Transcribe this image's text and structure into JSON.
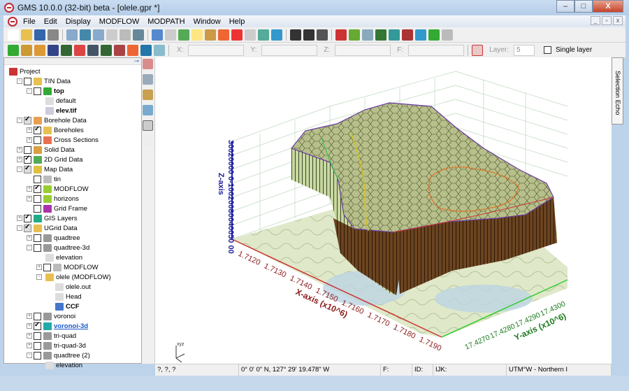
{
  "window": {
    "title": "GMS 10.0.0 (32-bit) beta - [olele.gpr *]",
    "minimize": "–",
    "maximize": "□",
    "close": "X"
  },
  "menu": [
    "File",
    "Edit",
    "Display",
    "MODFLOW",
    "MODPATH",
    "Window",
    "Help"
  ],
  "mdi": {
    "minimize": "_",
    "restore": "▫",
    "close": "x"
  },
  "coords": {
    "x_label": "X:",
    "y_label": "Y:",
    "z_label": "Z:",
    "f_label": "F:",
    "layer_label": "Layer:",
    "layer_value": "5",
    "single_layer": "Single layer"
  },
  "tree": [
    {
      "label": "Project",
      "level": 0,
      "exp": "",
      "chk": "none",
      "icon": "#c33",
      "style": ""
    },
    {
      "label": "TIN Data",
      "level": 1,
      "exp": "-",
      "chk": "off",
      "icon": "#e8c050",
      "style": ""
    },
    {
      "label": "top",
      "level": 2,
      "exp": "-",
      "chk": "off",
      "icon": "#3a3",
      "style": "bold"
    },
    {
      "label": "default",
      "level": 3,
      "exp": "",
      "chk": "none",
      "icon": "#ddd",
      "style": ""
    },
    {
      "label": "elev.tif",
      "level": 3,
      "exp": "",
      "chk": "none",
      "icon": "#ccd",
      "style": "bold"
    },
    {
      "label": "Borehole Data",
      "level": 1,
      "exp": "-",
      "chk": "grey",
      "icon": "#e8a050",
      "style": ""
    },
    {
      "label": "Boreholes",
      "level": 2,
      "exp": "+",
      "chk": "on",
      "icon": "#e8c050",
      "style": ""
    },
    {
      "label": "Cross Sections",
      "level": 2,
      "exp": "+",
      "chk": "off",
      "icon": "#e87050",
      "style": ""
    },
    {
      "label": "Solid Data",
      "level": 1,
      "exp": "+",
      "chk": "off",
      "icon": "#d9a040",
      "style": ""
    },
    {
      "label": "2D Grid Data",
      "level": 1,
      "exp": "+",
      "chk": "on",
      "icon": "#5a5",
      "style": ""
    },
    {
      "label": "Map Data",
      "level": 1,
      "exp": "-",
      "chk": "grey",
      "icon": "#e0c040",
      "style": ""
    },
    {
      "label": "tin",
      "level": 2,
      "exp": "",
      "chk": "off",
      "icon": "#bbb",
      "style": ""
    },
    {
      "label": "MODFLOW",
      "level": 2,
      "exp": "+",
      "chk": "on",
      "icon": "#9c3",
      "style": ""
    },
    {
      "label": "horizons",
      "level": 2,
      "exp": "+",
      "chk": "off",
      "icon": "#9c3",
      "style": ""
    },
    {
      "label": "Grid Frame",
      "level": 2,
      "exp": "",
      "chk": "off",
      "icon": "#a3a",
      "style": ""
    },
    {
      "label": "GIS Layers",
      "level": 1,
      "exp": "+",
      "chk": "on",
      "icon": "#2a8",
      "style": ""
    },
    {
      "label": "UGrid Data",
      "level": 1,
      "exp": "-",
      "chk": "grey",
      "icon": "#e8c050",
      "style": ""
    },
    {
      "label": "quadtree",
      "level": 2,
      "exp": "+",
      "chk": "off",
      "icon": "#999",
      "style": ""
    },
    {
      "label": "quadtree-3d",
      "level": 2,
      "exp": "-",
      "chk": "off",
      "icon": "#999",
      "style": ""
    },
    {
      "label": "elevation",
      "level": 3,
      "exp": "",
      "chk": "none",
      "icon": "#ddd",
      "style": ""
    },
    {
      "label": "MODFLOW",
      "level": 3,
      "exp": "+",
      "chk": "off",
      "icon": "#bbb",
      "style": ""
    },
    {
      "label": "olele (MODFLOW)",
      "level": 3,
      "exp": "-",
      "chk": "none",
      "icon": "#e8c050",
      "style": ""
    },
    {
      "label": "olele.out",
      "level": 4,
      "exp": "",
      "chk": "none",
      "icon": "#ddd",
      "style": ""
    },
    {
      "label": "Head",
      "level": 4,
      "exp": "",
      "chk": "none",
      "icon": "#ddd",
      "style": ""
    },
    {
      "label": "CCF",
      "level": 4,
      "exp": "",
      "chk": "none",
      "icon": "#47c",
      "style": "bold"
    },
    {
      "label": "voronoi",
      "level": 2,
      "exp": "+",
      "chk": "off",
      "icon": "#999",
      "style": ""
    },
    {
      "label": "voronoi-3d",
      "level": 2,
      "exp": "+",
      "chk": "on",
      "icon": "#2aa",
      "style": "link"
    },
    {
      "label": "tri-quad",
      "level": 2,
      "exp": "+",
      "chk": "off",
      "icon": "#999",
      "style": ""
    },
    {
      "label": "tri-quad-3d",
      "level": 2,
      "exp": "+",
      "chk": "off",
      "icon": "#999",
      "style": ""
    },
    {
      "label": "quadtree (2)",
      "level": 2,
      "exp": "-",
      "chk": "off",
      "icon": "#999",
      "style": ""
    },
    {
      "label": "elevation",
      "level": 3,
      "exp": "",
      "chk": "none",
      "icon": "#ddd",
      "style": ""
    }
  ],
  "viewport": {
    "z_axis": {
      "title": "Z-axis",
      "ticks": "30020000 0-10020080040050 00",
      "color": "#1a1a9a"
    },
    "x_axis": {
      "title": "X-axis (x10^6)",
      "ticks": [
        "1.7120",
        "1.7130",
        "1.7140",
        "1.7150",
        "1.7160",
        "1.7170",
        "1.7180",
        "1.7190"
      ],
      "color": "#8b1a1a"
    },
    "y_axis": {
      "title": "Y-axis (x10^6)",
      "ticks": [
        "17.4270",
        "17.4280",
        "17.4290",
        "17.4300"
      ],
      "color": "#1a7a1a"
    },
    "triad": "xyz"
  },
  "side_tab": "Selection Echo",
  "status": {
    "xyz": "?, ?, ?",
    "latlon": "0° 0' 0\" N, 127° 29' 19.478\" W",
    "f": "F:",
    "id": "ID:",
    "ijk": "IJK:",
    "proj": "UTM°W - Northern I"
  }
}
